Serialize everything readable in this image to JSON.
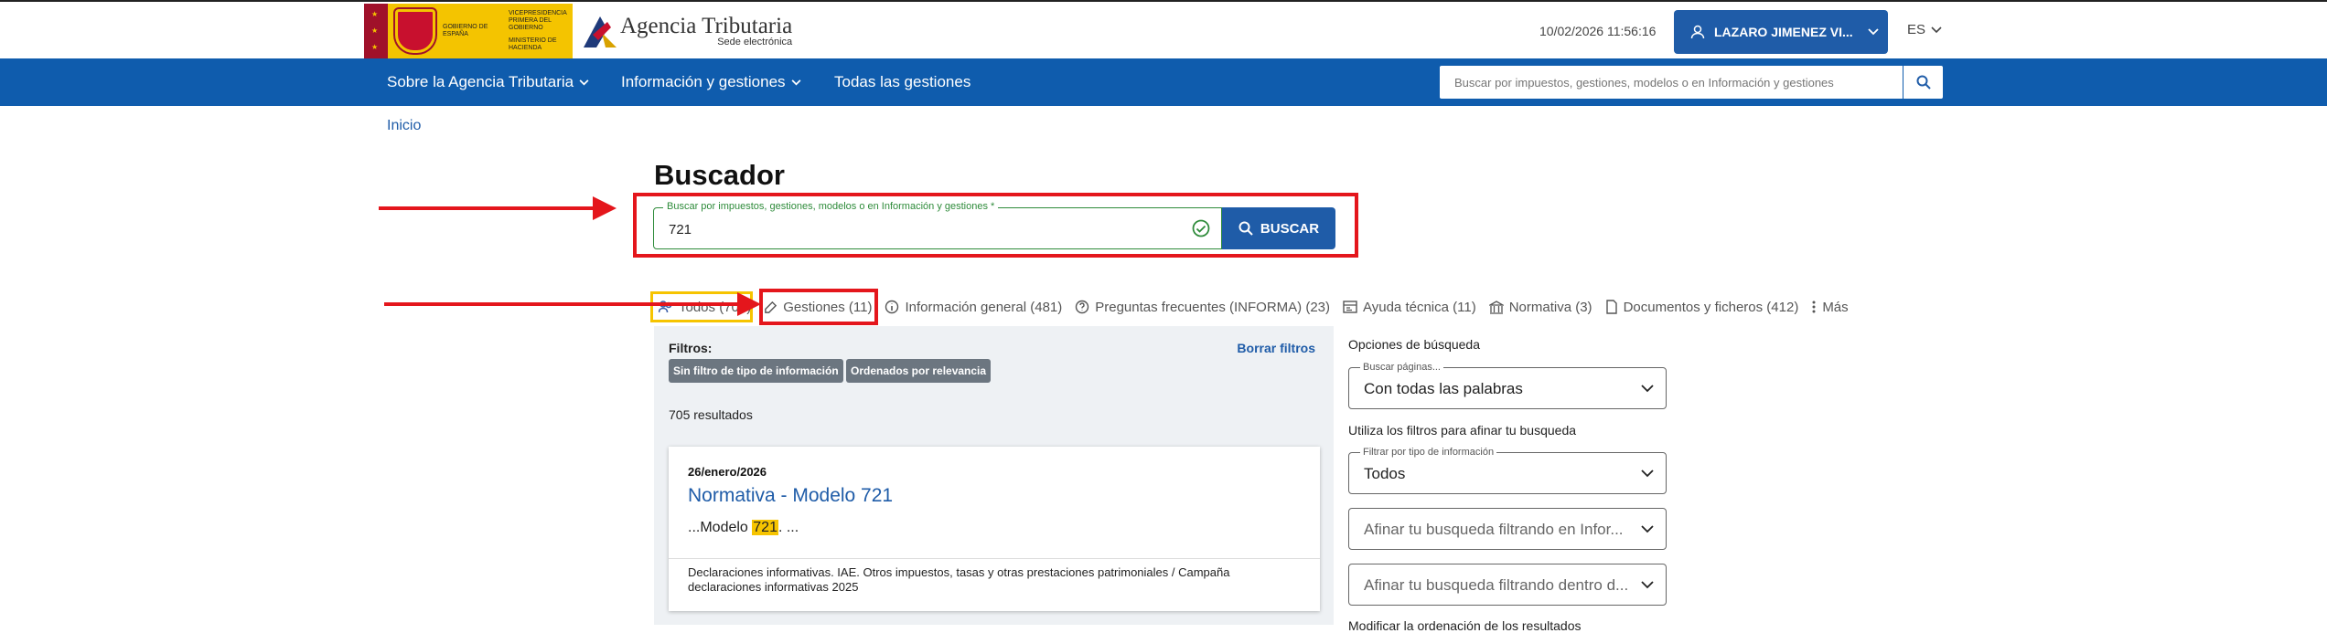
{
  "header": {
    "gov_logo_text_1": "VICEPRESIDENCIA PRIMERA DEL GOBIERNO",
    "gov_logo_text_2": "MINISTERIO DE HACIENDA",
    "gov_logo_text_3": "GOBIERNO DE ESPAÑA",
    "agency_name": "Agencia Tributaria",
    "agency_sub": "Sede electrónica",
    "datetime": "10/02/2026 11:56:16",
    "user_name": "LAZARO JIMENEZ VI...",
    "language": "ES"
  },
  "nav": {
    "items": [
      {
        "label": "Sobre la Agencia Tributaria"
      },
      {
        "label": "Información y gestiones"
      },
      {
        "label": "Todas las gestiones"
      }
    ],
    "search_placeholder": "Buscar por impuestos, gestiones, modelos o en Información y gestiones"
  },
  "breadcrumb": "Inicio",
  "page_title": "Buscador",
  "search": {
    "label": "Buscar por impuestos, gestiones, modelos o en Información y gestiones *",
    "value": "721",
    "button": "BUSCAR"
  },
  "tabs": [
    {
      "label": "Todos (705)",
      "icon": "people-icon"
    },
    {
      "label": "Gestiones (11)",
      "icon": "edit-icon"
    },
    {
      "label": "Información general (481)",
      "icon": "info-icon"
    },
    {
      "label": "Preguntas frecuentes (INFORMA) (23)",
      "icon": "question-icon"
    },
    {
      "label": "Ayuda técnica (11)",
      "icon": "card-icon"
    },
    {
      "label": "Normativa (3)",
      "icon": "building-icon"
    },
    {
      "label": "Documentos y ficheros (412)",
      "icon": "document-icon"
    },
    {
      "label": "Más",
      "icon": "more-icon"
    }
  ],
  "filters": {
    "label": "Filtros:",
    "clear": "Borrar filtros",
    "chips": [
      "Sin filtro de tipo de información",
      "Ordenados por relevancia"
    ]
  },
  "results": {
    "count": "705 resultados",
    "items": [
      {
        "date": "26/enero/2026",
        "title": "Normativa - Modelo 721",
        "snippet_before": "...Modelo ",
        "snippet_highlight": "721",
        "snippet_after": ". ...",
        "footer": "Declaraciones informativas. IAE. Otros impuestos, tasas y otras prestaciones patrimoniales / Campaña declaraciones informativas 2025"
      }
    ]
  },
  "options": {
    "heading": "Opciones de búsqueda",
    "search_pages_label": "Buscar páginas...",
    "search_pages_value": "Con todas las palabras",
    "filter_hint": "Utiliza los filtros para afinar tu busqueda",
    "type_label": "Filtrar por tipo de información",
    "type_value": "Todos",
    "refine_info_placeholder": "Afinar tu busqueda filtrando en Infor...",
    "refine_within_placeholder": "Afinar tu busqueda filtrando dentro d...",
    "sort_heading": "Modificar la ordenación de los resultados"
  },
  "colors": {
    "brand_blue": "#0f5cad",
    "button_blue": "#1f5ca8",
    "annotation_red": "#e4161c",
    "annotation_yellow": "#f6c400",
    "valid_green": "#2e8b3a"
  }
}
